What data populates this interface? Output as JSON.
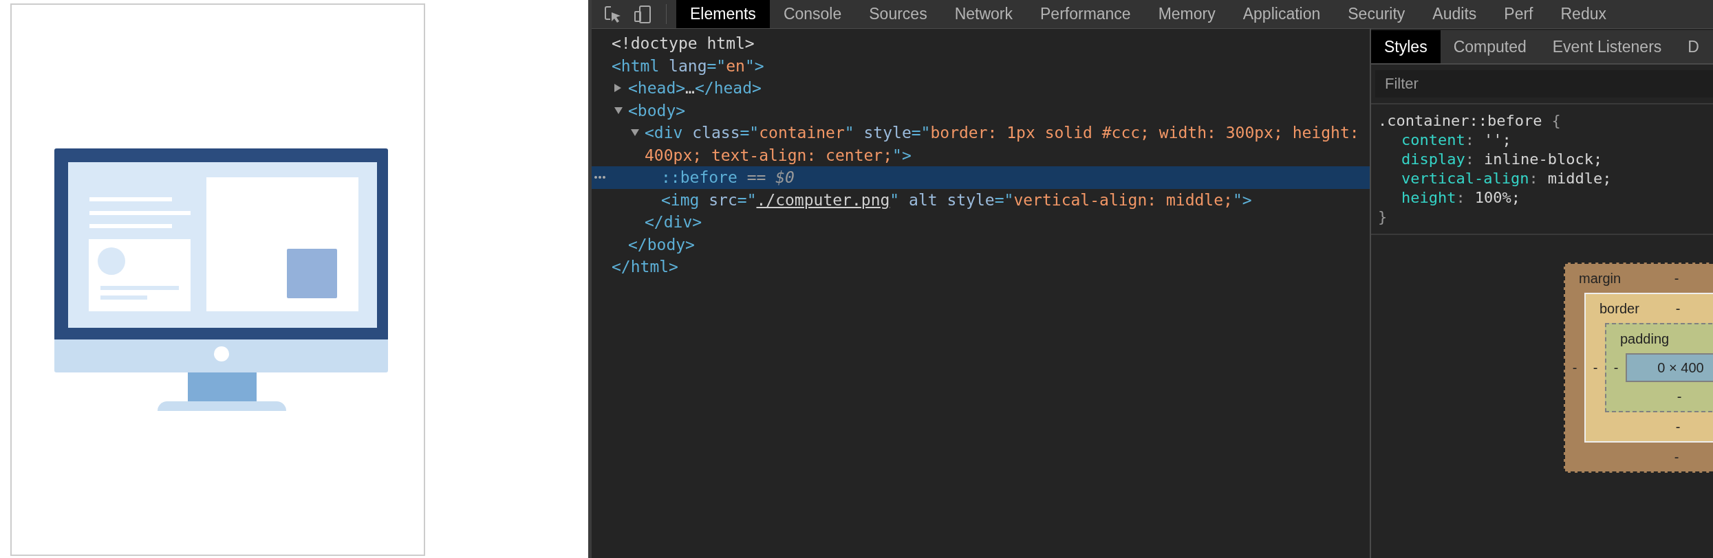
{
  "devtools": {
    "tabs": [
      {
        "label": "Elements",
        "selected": true
      },
      {
        "label": "Console",
        "selected": false
      },
      {
        "label": "Sources",
        "selected": false
      },
      {
        "label": "Network",
        "selected": false
      },
      {
        "label": "Performance",
        "selected": false
      },
      {
        "label": "Memory",
        "selected": false
      },
      {
        "label": "Application",
        "selected": false
      },
      {
        "label": "Security",
        "selected": false
      },
      {
        "label": "Audits",
        "selected": false
      },
      {
        "label": "Perf",
        "selected": false
      },
      {
        "label": "Redux",
        "selected": false
      }
    ]
  },
  "dom_tree": [
    {
      "selected": false,
      "segments": [
        {
          "kind": "text",
          "text": "<!doctype html>"
        }
      ]
    },
    {
      "selected": false,
      "segments": [
        {
          "kind": "tag",
          "text": "<html"
        },
        {
          "kind": "attr",
          "text": " lang"
        },
        {
          "kind": "tag",
          "text": "=\""
        },
        {
          "kind": "value",
          "text": "en"
        },
        {
          "kind": "tag",
          "text": "\">"
        }
      ],
      "closing": [
        {
          "kind": "tag",
          "text": "</html>"
        }
      ],
      "children": [
        {
          "selected": false,
          "expanded": false,
          "segments": [
            {
              "kind": "tag",
              "text": "<head>"
            },
            {
              "kind": "text",
              "text": "…"
            },
            {
              "kind": "tag",
              "text": "</head>"
            }
          ]
        },
        {
          "selected": false,
          "expanded": true,
          "segments": [
            {
              "kind": "tag",
              "text": "<body>"
            }
          ],
          "closing": [
            {
              "kind": "tag",
              "text": "</body>"
            }
          ],
          "children": [
            {
              "selected": false,
              "expanded": true,
              "segments": [
                {
                  "kind": "tag",
                  "text": "<div"
                },
                {
                  "kind": "attr",
                  "text": " class"
                },
                {
                  "kind": "tag",
                  "text": "=\""
                },
                {
                  "kind": "value",
                  "text": "container"
                },
                {
                  "kind": "tag",
                  "text": "\""
                },
                {
                  "kind": "attr",
                  "text": " style"
                },
                {
                  "kind": "tag",
                  "text": "=\""
                },
                {
                  "kind": "value",
                  "text": "border: 1px solid #ccc; width: 300px; height: 400px; text-align: center;"
                },
                {
                  "kind": "tag",
                  "text": "\">"
                }
              ],
              "closing": [
                {
                  "kind": "tag",
                  "text": "</div>"
                }
              ],
              "children": [
                {
                  "selected": true,
                  "segments": [
                    {
                      "kind": "tag",
                      "text": "::before"
                    },
                    {
                      "kind": "muted",
                      "text": " == "
                    },
                    {
                      "kind": "var",
                      "text": "$0"
                    }
                  ]
                },
                {
                  "selected": false,
                  "segments": [
                    {
                      "kind": "tag",
                      "text": "<img"
                    },
                    {
                      "kind": "attr",
                      "text": " src"
                    },
                    {
                      "kind": "tag",
                      "text": "=\""
                    },
                    {
                      "kind": "link",
                      "text": "./computer.png"
                    },
                    {
                      "kind": "tag",
                      "text": "\""
                    },
                    {
                      "kind": "attr",
                      "text": " alt style"
                    },
                    {
                      "kind": "tag",
                      "text": "=\""
                    },
                    {
                      "kind": "value",
                      "text": "vertical-align: middle;"
                    },
                    {
                      "kind": "tag",
                      "text": "\">"
                    }
                  ]
                }
              ]
            }
          ]
        }
      ]
    }
  ],
  "sidebar": {
    "tabs": [
      {
        "label": "Styles",
        "selected": true
      },
      {
        "label": "Computed",
        "selected": false
      },
      {
        "label": "Event Listeners",
        "selected": false
      },
      {
        "label": "D",
        "selected": false
      }
    ],
    "filter": {
      "placeholder": "Filter"
    },
    "rule": {
      "selector": ".container::before",
      "open": "{",
      "close": "}",
      "properties": [
        {
          "name": "content",
          "separator": ":",
          "value": "'';"
        },
        {
          "name": "display",
          "separator": ":",
          "value": "inline-block;"
        },
        {
          "name": "vertical-align",
          "separator": ":",
          "value": "middle;"
        },
        {
          "name": "height",
          "separator": ":",
          "value": "100%;"
        }
      ]
    },
    "box_model": {
      "margin": {
        "label": "margin",
        "top": "-",
        "left": "-",
        "bottom": "-"
      },
      "border": {
        "label": "border",
        "top": "-",
        "left": "-",
        "bottom": "-"
      },
      "padding": {
        "label": "padding",
        "left": "-",
        "bottom": "-"
      },
      "content": "0 × 400"
    }
  }
}
